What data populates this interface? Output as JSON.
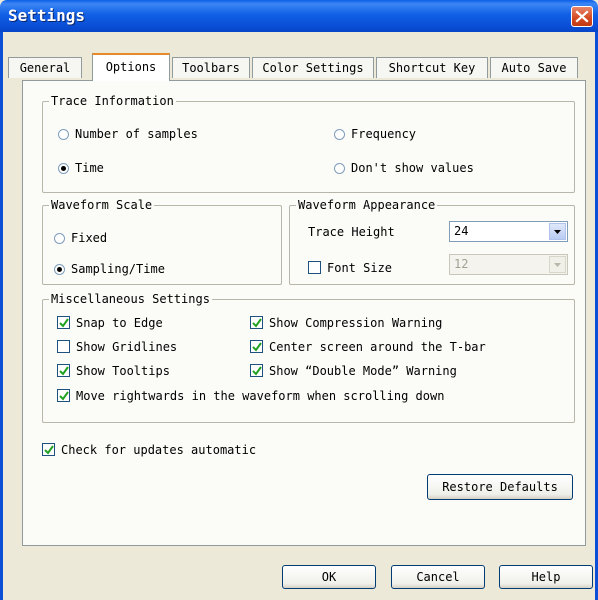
{
  "window": {
    "title": "Settings"
  },
  "tabs": [
    "General",
    "Options",
    "Toolbars",
    "Color Settings",
    "Shortcut Key",
    "Auto Save"
  ],
  "trace_information": {
    "legend": "Trace Information",
    "options": [
      "Number of samples",
      "Frequency",
      "Time",
      "Don't show values"
    ],
    "selected": "Time"
  },
  "waveform_scale": {
    "legend": "Waveform Scale",
    "options": [
      "Fixed",
      "Sampling/Time"
    ],
    "selected": "Sampling/Time"
  },
  "waveform_appearance": {
    "legend": "Waveform Appearance",
    "trace_height_label": "Trace Height",
    "trace_height_value": "24",
    "font_size_label": "Font Size",
    "font_size_checked": false,
    "font_size_value": "12"
  },
  "misc": {
    "legend": "Miscellaneous Settings",
    "snap_to_edge": "Snap to Edge",
    "show_gridlines": "Show Gridlines",
    "show_tooltips": "Show Tooltips",
    "show_compression_warning": "Show Compression Warning",
    "center_screen": "Center screen around the T-bar",
    "double_mode_warning": "Show “Double Mode” Warning",
    "move_rightwards": "Move rightwards in the waveform when scrolling down"
  },
  "check_updates": "Check for updates automatic",
  "buttons": {
    "restore_defaults": "Restore Defaults",
    "ok": "OK",
    "cancel": "Cancel",
    "help": "Help"
  }
}
